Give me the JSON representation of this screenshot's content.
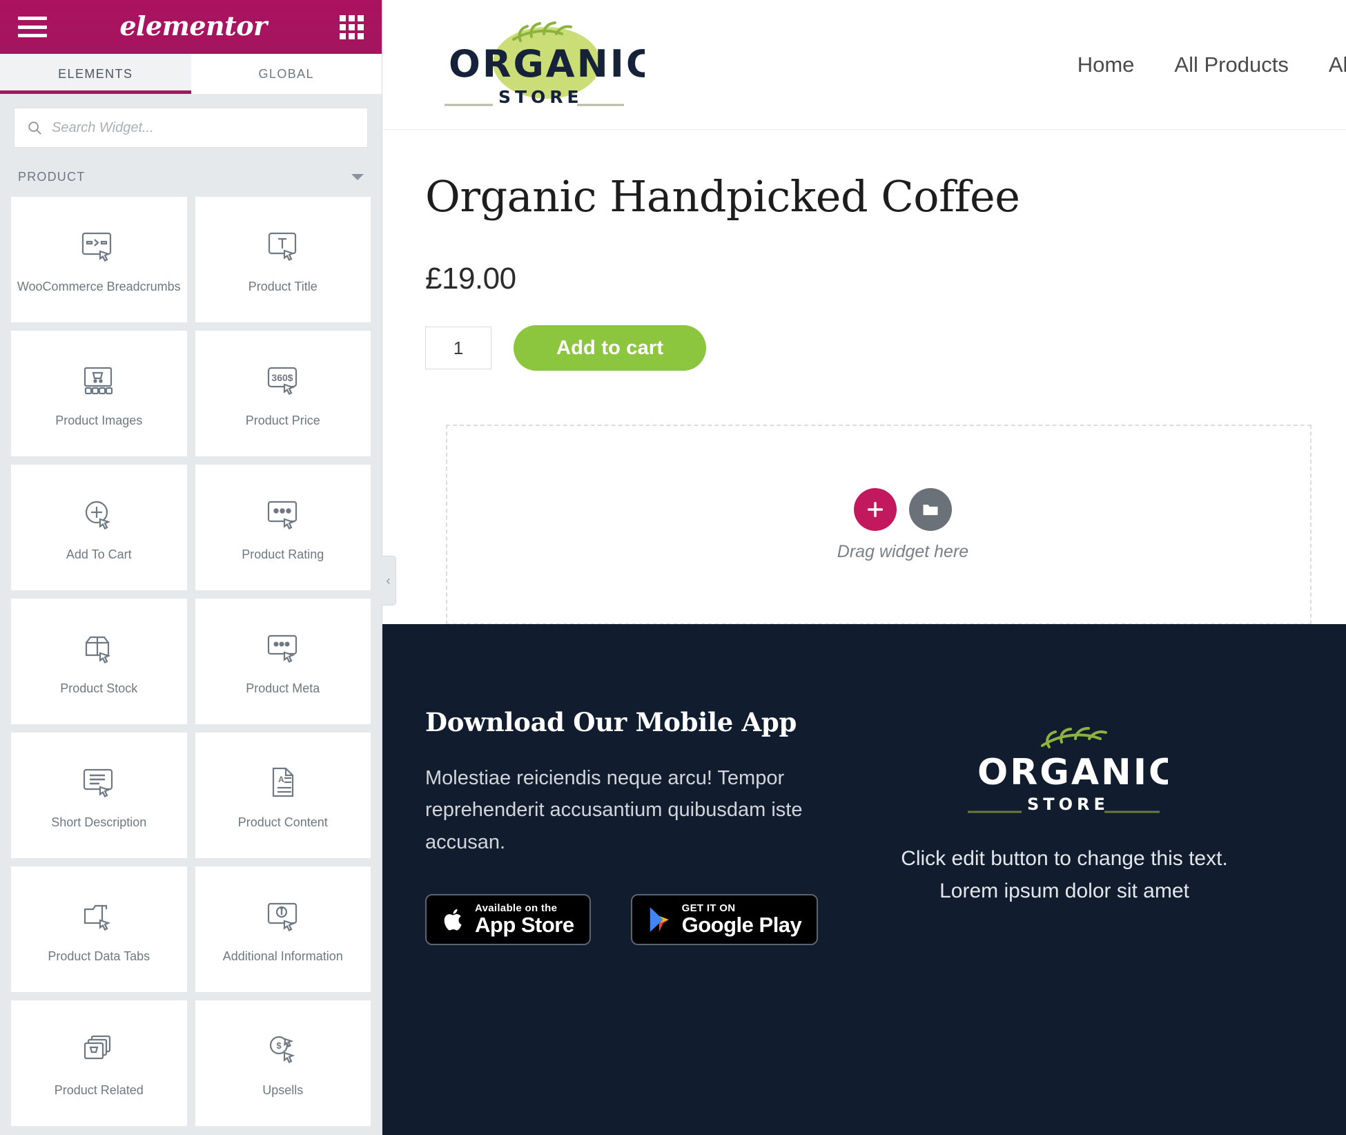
{
  "panel": {
    "brand": "elementor",
    "menu_icon": "hamburger-icon",
    "apps_icon": "grid-apps-icon",
    "tabs": [
      {
        "label": "ELEMENTS",
        "active": true
      },
      {
        "label": "GLOBAL",
        "active": false
      }
    ],
    "search": {
      "placeholder": "Search Widget...",
      "value": ""
    },
    "category": {
      "label": "PRODUCT",
      "expanded": true
    },
    "widgets": [
      {
        "label": "WooCommerce Breadcrumbs",
        "icon": "breadcrumbs-widget-icon"
      },
      {
        "label": "Product Title",
        "icon": "product-title-widget-icon"
      },
      {
        "label": "Product Images",
        "icon": "product-images-widget-icon"
      },
      {
        "label": "Product Price",
        "icon": "product-price-widget-icon"
      },
      {
        "label": "Add To Cart",
        "icon": "add-to-cart-widget-icon"
      },
      {
        "label": "Product Rating",
        "icon": "product-rating-widget-icon"
      },
      {
        "label": "Product Stock",
        "icon": "product-stock-widget-icon"
      },
      {
        "label": "Product Meta",
        "icon": "product-meta-widget-icon"
      },
      {
        "label": "Short Description",
        "icon": "short-description-widget-icon"
      },
      {
        "label": "Product Content",
        "icon": "product-content-widget-icon"
      },
      {
        "label": "Product Data Tabs",
        "icon": "product-data-tabs-widget-icon"
      },
      {
        "label": "Additional Information",
        "icon": "additional-information-widget-icon"
      },
      {
        "label": "Product Related",
        "icon": "product-related-widget-icon"
      },
      {
        "label": "Upsells",
        "icon": "upsells-widget-icon"
      }
    ],
    "collapse_handle": "‹",
    "accent_color": "#a4155e"
  },
  "site": {
    "logo": {
      "name": "ORGANIC",
      "tagline": "STORE"
    },
    "nav": [
      {
        "label": "Home"
      },
      {
        "label": "All Products"
      },
      {
        "label": "Abo"
      }
    ]
  },
  "product": {
    "title": "Organic Handpicked Coffee",
    "price": "£19.00",
    "quantity": "1",
    "add_to_cart_label": "Add to cart",
    "button_color": "#8cc63f"
  },
  "dropzone": {
    "add_icon": "plus-icon",
    "folder_icon": "folder-icon",
    "label": "Drag widget here",
    "add_color": "#c2195e",
    "folder_color": "#6a7179"
  },
  "footer": {
    "heading": "Download Our Mobile App",
    "text": "Molestiae reiciendis neque arcu! Tempor reprehenderit accusantium quibusdam iste accusan.",
    "badges": [
      {
        "small": "Available on the",
        "big": "App Store",
        "icon": "apple-icon"
      },
      {
        "small": "GET IT ON",
        "big": "Google Play",
        "icon": "google-play-icon"
      }
    ],
    "logo": {
      "name": "ORGANIC",
      "tagline": "STORE"
    },
    "note_line1": "Click edit button to change this text.",
    "note_line2": "Lorem ipsum dolor sit amet",
    "background_color": "#111d2e"
  }
}
